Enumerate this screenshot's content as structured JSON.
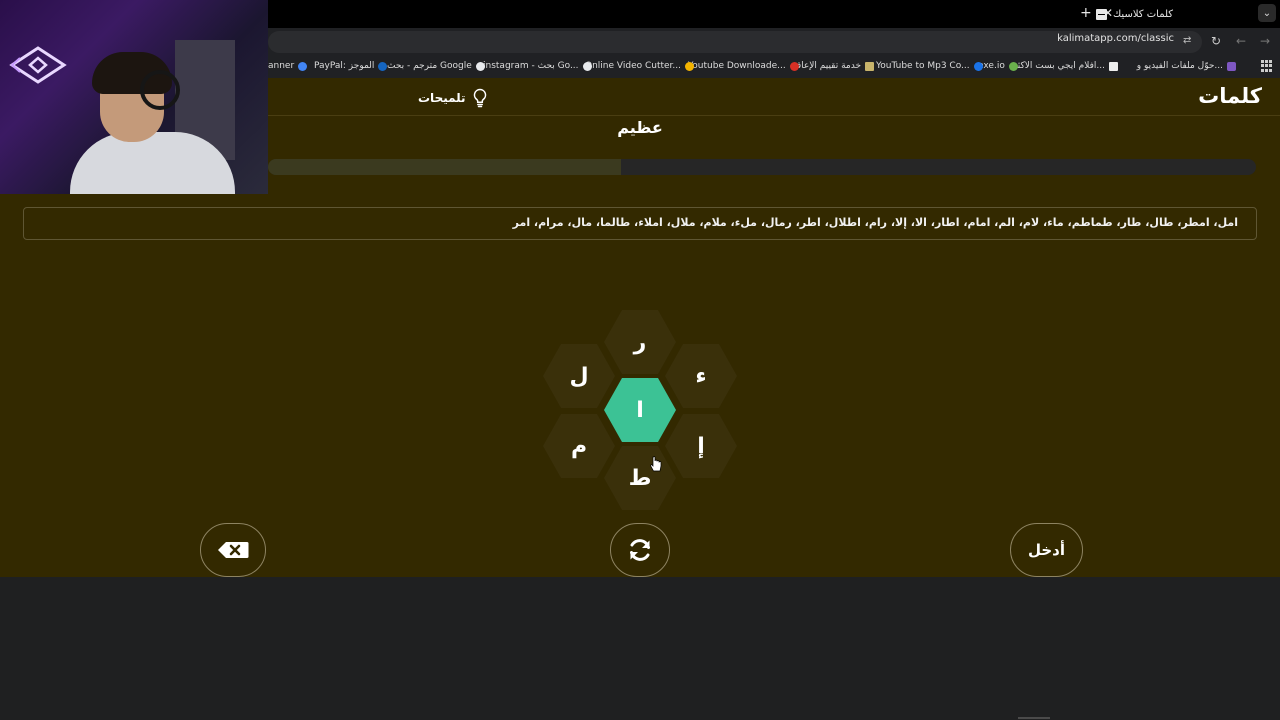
{
  "browser": {
    "tab_title": "كلمات كلاسيك",
    "url": "kalimatapp.com/classic",
    "bookmarks": [
      "حوّل ملفات الفيديو و...",
      "افلام ايجي بست الاكثر...",
      "exe.io",
      "YouTube to Mp3 Co...",
      "خدمة تقييم الإعاقة",
      "Youtube Downloade...",
      "Online Video Cutter...",
      "instagram - بحث Go...",
      "مترجم - بحث Google",
      "PayPal: الموجز",
      "anner"
    ]
  },
  "app": {
    "logo": "كلمات",
    "hints_label": "تلميحات",
    "rank": "عظيم",
    "progress_fraction": 0.357,
    "found_words": "امل، امطر، طال، طار، طماطم، ماء، لام، الم، امام، اطار، الا، إلا، رام، اطلال، اطر، رمال، ملء، ملام، ملال، املاء، طالما، مال، مرام، امر"
  },
  "letters": {
    "top": "ر",
    "upper_left": "ل",
    "upper_right": "ء",
    "center": "ا",
    "lower_left": "م",
    "lower_right": "إ",
    "bottom": "ط"
  },
  "controls": {
    "enter_label": "أدخل"
  },
  "colors": {
    "page_bg": "#332900",
    "center_hex": "#3cc295",
    "outer_hex": "#3a300a"
  }
}
